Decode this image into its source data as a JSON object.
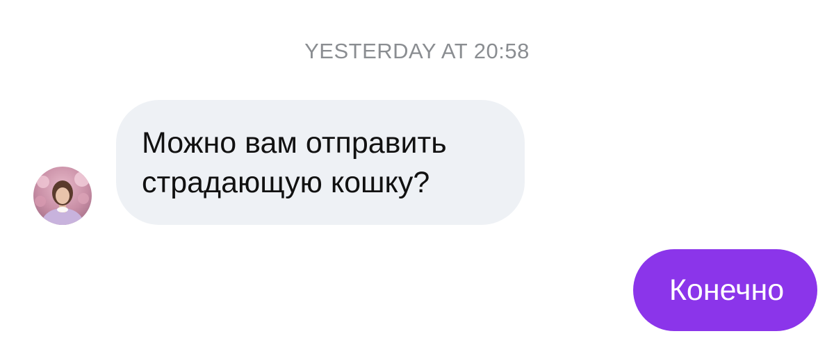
{
  "thread": {
    "timestamp": "YESTERDAY AT 20:58",
    "messages": [
      {
        "direction": "incoming",
        "text": "Можно вам отправить\nстрадающую кошку?",
        "bubble_color": "#eef1f5"
      },
      {
        "direction": "outgoing",
        "text": "Конечно",
        "bubble_color": "#8b35ea"
      }
    ]
  }
}
